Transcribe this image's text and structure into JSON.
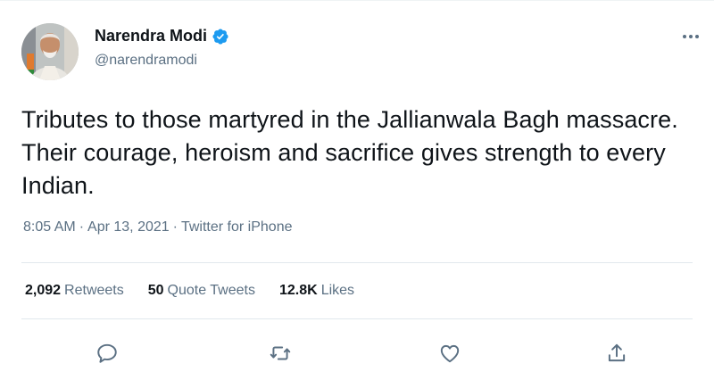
{
  "user": {
    "name": "Narendra Modi",
    "handle": "@narendramodi"
  },
  "tweet": {
    "text": "Tributes to those martyred in the Jallianwala Bagh massacre. Their courage, heroism and sacrifice gives strength to every Indian.",
    "time": "8:05 AM",
    "date": "Apr 13, 2021",
    "source": "Twitter for iPhone",
    "separator": "·"
  },
  "stats": {
    "retweets_count": "2,092",
    "retweets_label": "Retweets",
    "quotes_count": "50",
    "quotes_label": "Quote Tweets",
    "likes_count": "12.8K",
    "likes_label": "Likes"
  },
  "icons": {
    "more": "more-icon",
    "verified": "verified-badge-icon",
    "reply": "reply-icon",
    "retweet": "retweet-icon",
    "like": "like-icon",
    "share": "share-icon"
  },
  "colors": {
    "text": "#0f1419",
    "secondary": "#5b7083",
    "verified": "#1d9bf0",
    "divider": "#e1e8ed"
  }
}
